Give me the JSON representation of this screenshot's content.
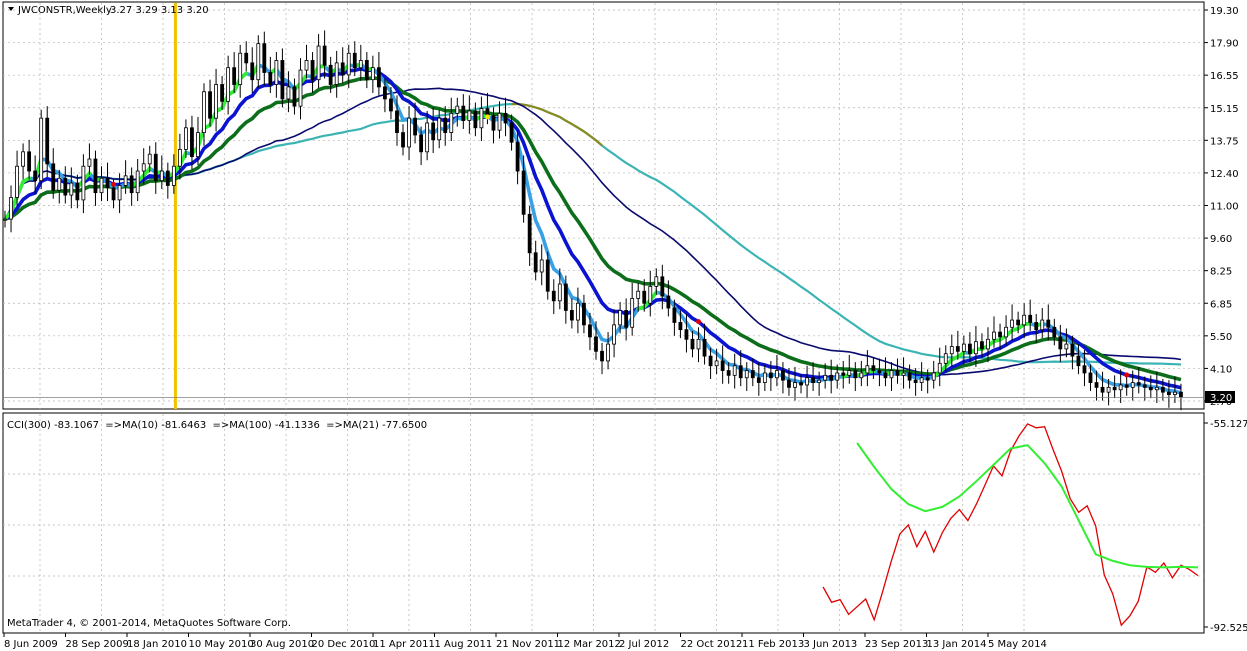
{
  "header": {
    "symbol": "JWCONSTR,Weekly",
    "ohlc": "3.27 3.29 3.13 3.20"
  },
  "indicator_header": "CCI(300) -83.1067  =>MA(10) -81.6463  =>MA(100) -41.1336  =>MA(21) -77.6500",
  "copyright": "MetaTrader 4, © 2001-2014, MetaQuotes Software Corp.",
  "current_price_label": "3.20",
  "colors": {
    "ema_fast": "#39a0e6",
    "ema_fast_up": "#33ee33",
    "ema_mid": "#0a14d0",
    "ema_slow": "#0c6e1a",
    "ma_long": "#0a0a6e",
    "ma_xlong": "#3cb4b4",
    "candle": "#000000",
    "cci": "#e00000",
    "cci_ma": "#33ee33",
    "vline": "#f2c400",
    "grid": "#b4b4b4"
  },
  "chart_data": [
    {
      "type": "line",
      "panel": "price",
      "title": "JWCONSTR,Weekly",
      "y_ticks": [
        "19.30",
        "17.90",
        "16.55",
        "15.15",
        "13.75",
        "12.40",
        "11.00",
        "9.60",
        "8.25",
        "6.85",
        "5.50",
        "4.10",
        "2.70"
      ],
      "ylim": [
        2.7,
        19.3
      ],
      "x_ticks": [
        "8 Jun 2009",
        "28 Sep 2009",
        "18 Jan 2010",
        "10 May 2010",
        "30 Aug 2010",
        "20 Dec 2010",
        "11 Apr 2011",
        "1 Aug 2011",
        "21 Nov 2011",
        "12 Mar 2012",
        "2 Jul 2012",
        "22 Oct 2012",
        "11 Feb 2013",
        "3 Jun 2013",
        "23 Sep 2013",
        "13 Jan 2014",
        "5 May 2014"
      ],
      "xlim": [
        0,
        280
      ],
      "vertical_marker_x": 40,
      "candles_close": [
        10.6,
        11.5,
        12.8,
        13.4,
        12.6,
        12.2,
        14.8,
        12.9,
        11.8,
        12.3,
        11.6,
        12.1,
        11.4,
        12.8,
        13.1,
        11.7,
        12.3,
        11.9,
        11.4,
        12.0,
        12.4,
        11.7,
        12.6,
        12.9,
        13.3,
        12.2,
        12.6,
        12.0,
        12.8,
        13.5,
        14.4,
        13.2,
        14.2,
        15.9,
        14.8,
        16.2,
        15.5,
        16.9,
        16.2,
        17.5,
        17.1,
        16.4,
        17.9,
        16.7,
        16.2,
        17.2,
        15.6,
        16.1,
        15.3,
        16.8,
        17.2,
        16.4,
        17.8,
        17.0,
        16.2,
        17.1,
        16.6,
        17.5,
        16.9,
        17.2,
        16.4,
        16.9,
        16.1,
        15.6,
        15.1,
        14.2,
        13.6,
        14.8,
        14.1,
        13.4,
        14.6,
        13.9,
        14.8,
        14.2,
        15.0,
        15.3,
        14.7,
        15.1,
        14.4,
        15.2,
        14.9,
        14.3,
        15.0,
        14.6,
        13.8,
        12.6,
        10.8,
        9.2,
        8.4,
        8.9,
        7.6,
        7.2,
        7.9,
        6.8,
        6.4,
        7.1,
        6.2,
        5.7,
        5.1,
        4.7,
        5.4,
        6.2,
        6.8,
        6.1,
        7.3,
        7.6,
        7.1,
        7.8,
        8.2,
        7.4,
        6.9,
        6.3,
        6.0,
        5.6,
        5.2,
        5.6,
        4.9,
        4.5,
        4.7,
        4.3,
        4.1,
        4.5,
        4.0,
        4.3,
        4.0,
        3.8,
        4.2,
        4.0,
        4.3,
        3.9,
        3.6,
        3.8,
        3.7,
        4.0,
        3.8,
        3.9,
        4.1,
        3.9,
        4.2,
        4.1,
        4.3,
        4.0,
        4.2,
        4.5,
        4.3,
        4.2,
        4.0,
        4.3,
        4.1,
        4.2,
        3.9,
        3.8,
        4.0,
        3.9,
        4.2,
        4.6,
        5.0,
        5.3,
        5.1,
        5.4,
        5.0,
        5.5,
        5.2,
        5.6,
        5.9,
        5.7,
        6.1,
        6.4,
        6.2,
        6.6,
        6.3,
        6.0,
        6.4,
        6.1,
        5.7,
        5.2,
        5.4,
        4.9,
        4.5,
        4.2,
        3.8,
        3.6,
        3.4,
        3.6,
        3.5,
        3.7,
        3.6,
        3.8,
        3.7,
        3.6,
        3.5,
        3.6,
        3.4,
        3.3,
        3.4,
        3.2
      ]
    },
    {
      "type": "line",
      "panel": "indicator",
      "title": "CCI(300)",
      "y_ticks": [
        "-55.1278",
        "-92.5255"
      ],
      "ylim": [
        -92.5255,
        -55.1278
      ],
      "series": [
        {
          "name": "CCI(300)",
          "x": [
            192,
            194,
            196,
            198,
            200,
            202,
            204,
            206,
            208,
            210,
            212,
            214,
            216,
            218,
            220,
            222,
            224,
            226,
            228,
            230,
            232,
            234,
            236,
            238,
            240,
            242,
            244,
            246,
            248,
            250,
            252,
            254,
            256,
            258,
            260,
            262,
            264,
            266,
            268,
            270,
            272,
            274,
            276,
            278,
            280
          ],
          "values": [
            -85.2,
            -88.0,
            -87.5,
            -90.2,
            -88.8,
            -87.4,
            -91.2,
            -86.0,
            -80.5,
            -75.5,
            -73.8,
            -77.8,
            -75.0,
            -78.8,
            -75.2,
            -72.6,
            -71.0,
            -73.0,
            -70.0,
            -66.5,
            -63.0,
            -64.8,
            -60.3,
            -57.5,
            -55.3,
            -56.0,
            -55.8,
            -60.0,
            -64.0,
            -69.0,
            -71.5,
            -70.3,
            -74.0,
            -83.0,
            -86.5,
            -92.2,
            -90.5,
            -87.8,
            -81.5,
            -82.5,
            -80.8,
            -83.5,
            -81.2,
            -82.0,
            -83.1
          ]
        },
        {
          "name": "MA(10)",
          "x": [
            200,
            204,
            208,
            212,
            216,
            220,
            224,
            228,
            232,
            236,
            240,
            244,
            248,
            252,
            256,
            260,
            264,
            268,
            272,
            276,
            280
          ],
          "values": [
            -58.8,
            -63.2,
            -67.2,
            -70.0,
            -71.3,
            -70.5,
            -68.6,
            -65.8,
            -62.8,
            -59.8,
            -59.2,
            -62.5,
            -66.8,
            -73.0,
            -79.2,
            -80.4,
            -81.2,
            -81.5,
            -81.6,
            -81.5,
            -81.6
          ]
        }
      ]
    }
  ]
}
